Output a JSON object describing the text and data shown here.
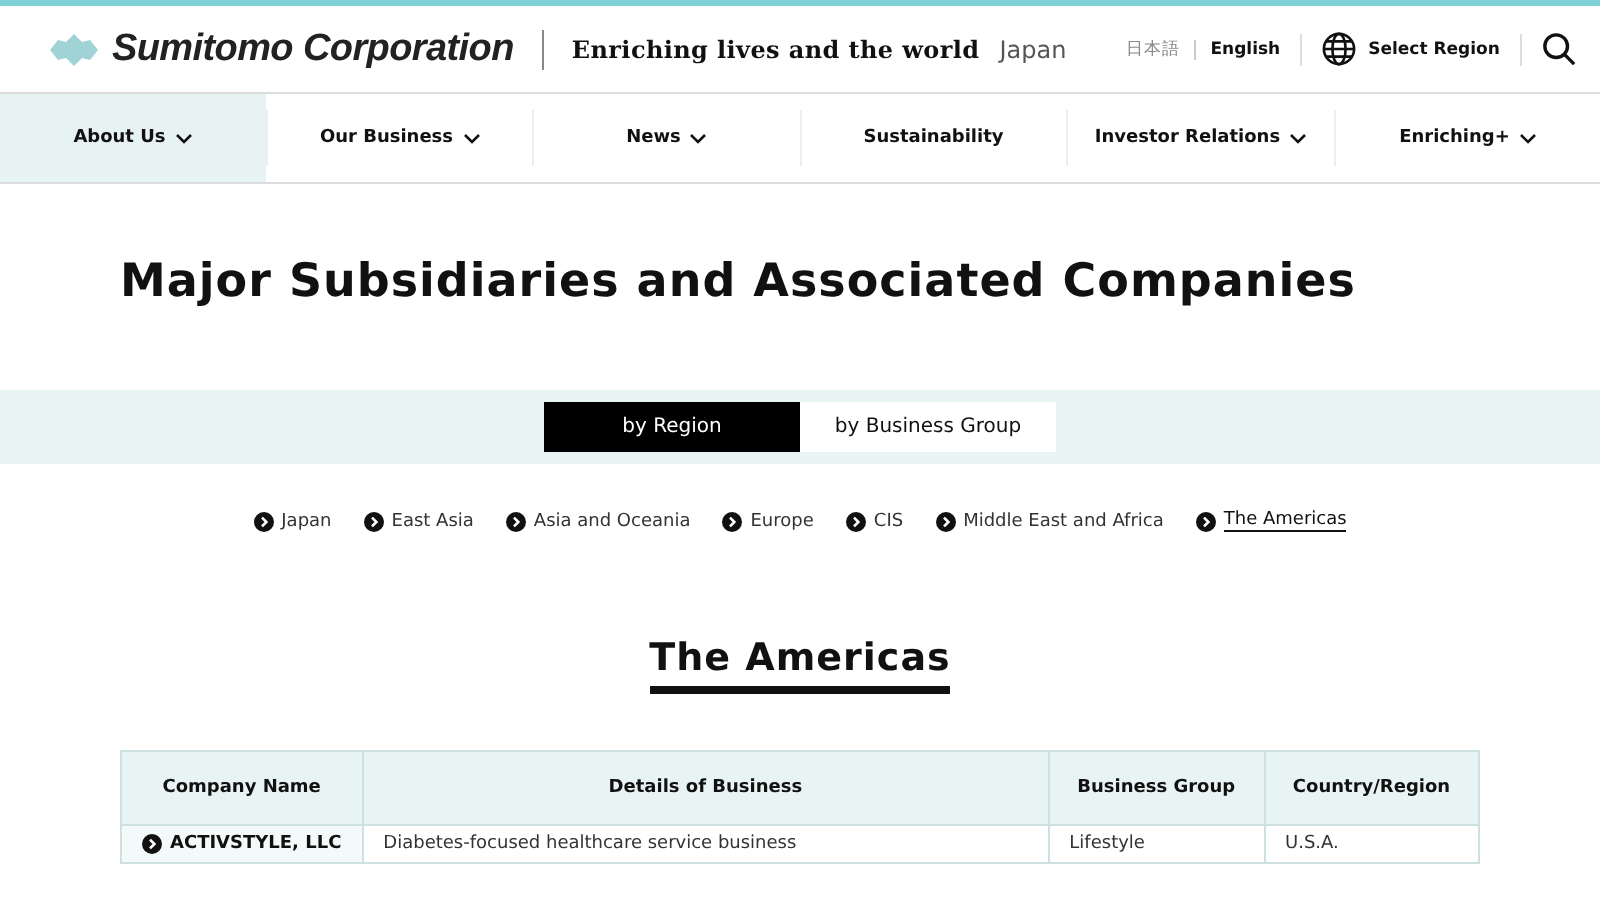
{
  "header": {
    "logo": "Sumitomo Corporation",
    "tagline": "Enriching lives and the world",
    "country": "Japan",
    "languages": [
      {
        "label": "日本語",
        "selected": false
      },
      {
        "label": "English",
        "selected": true
      }
    ],
    "region_button": "Select Region"
  },
  "nav": [
    {
      "label": "About Us",
      "selected": true,
      "dropdown": true
    },
    {
      "label": "Our Business",
      "selected": false,
      "dropdown": true
    },
    {
      "label": "News",
      "selected": false,
      "dropdown": true
    },
    {
      "label": "Sustainability",
      "selected": false,
      "dropdown": false
    },
    {
      "label": "Investor Relations",
      "selected": false,
      "dropdown": true
    },
    {
      "label": "Enriching+",
      "selected": false,
      "dropdown": true
    }
  ],
  "title": "Major Subsidiaries and Associated Companies",
  "tabs": [
    {
      "label": "by Region",
      "selected": true
    },
    {
      "label": "by Business Group",
      "selected": false
    }
  ],
  "regions": [
    {
      "label": "Japan",
      "selected": false
    },
    {
      "label": "East Asia",
      "selected": false
    },
    {
      "label": "Asia and Oceania",
      "selected": false
    },
    {
      "label": "Europe",
      "selected": false
    },
    {
      "label": "CIS",
      "selected": false
    },
    {
      "label": "Middle East and Africa",
      "selected": false
    },
    {
      "label": "The Americas",
      "selected": true
    }
  ],
  "section_heading": "The Americas",
  "table": {
    "columns": [
      "Company Name",
      "Details of Business",
      "Business Group",
      "Country/Region"
    ],
    "rows": [
      [
        "ACTIVSTYLE, LLC",
        "Diabetes-focused healthcare service business",
        "Lifestyle",
        "U.S.A."
      ]
    ]
  }
}
